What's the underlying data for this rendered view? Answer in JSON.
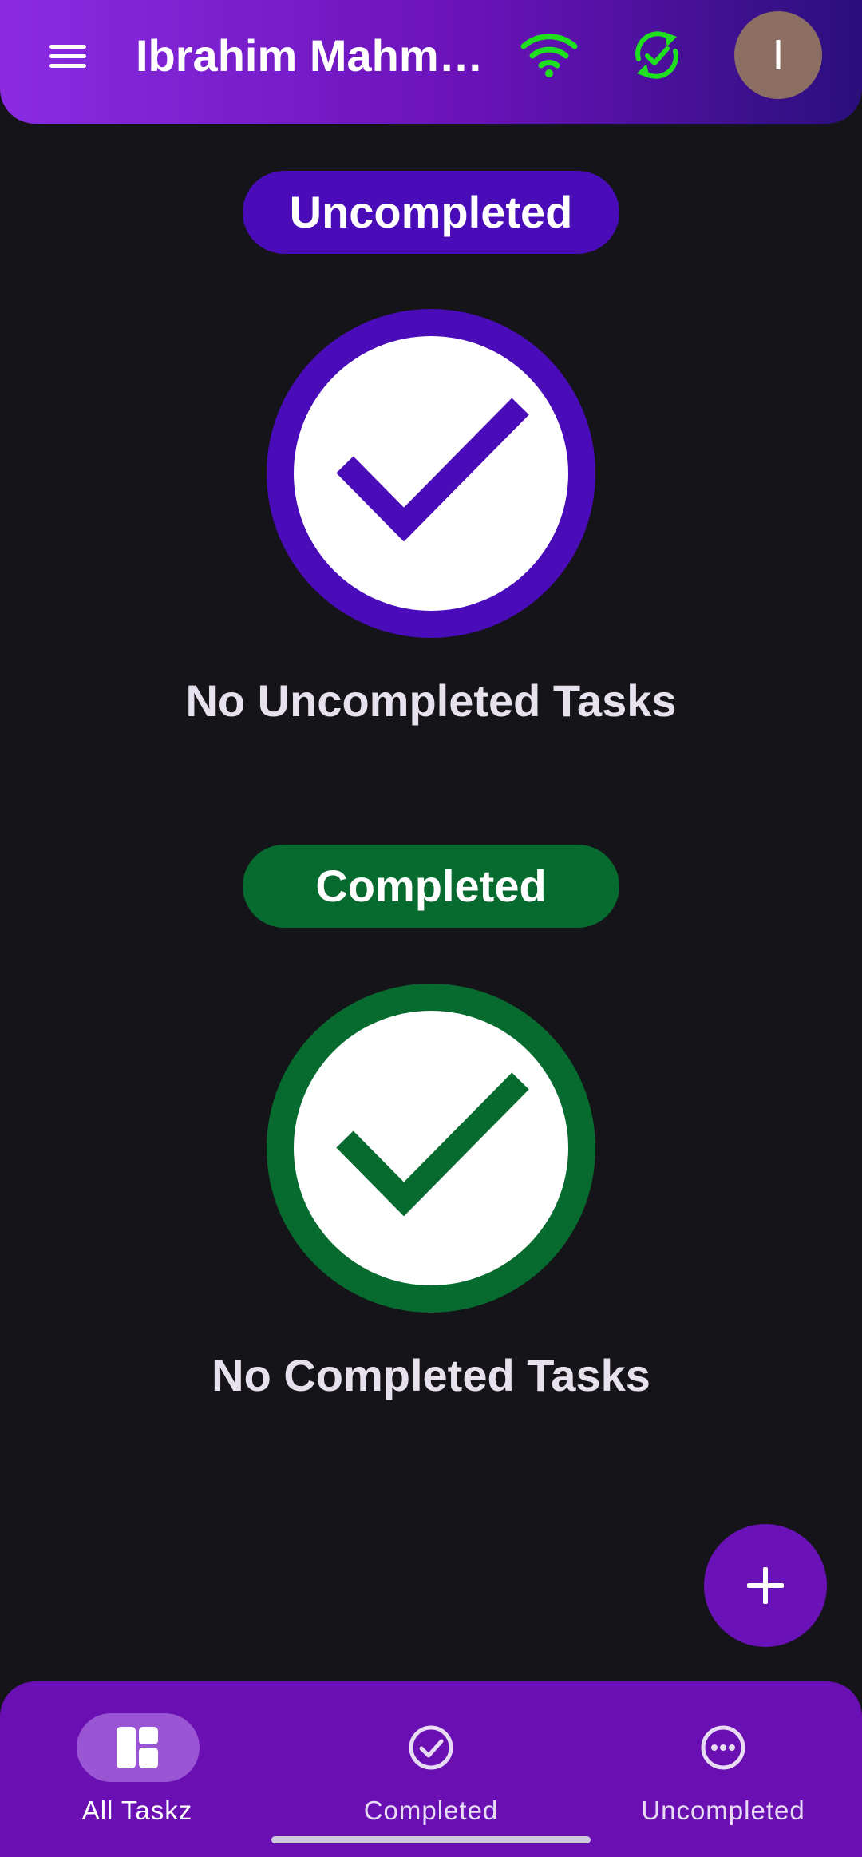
{
  "app_bar": {
    "title": "Ibrahim Mahmoud",
    "menu_icon": "menu-icon",
    "wifi_icon": "wifi-icon",
    "sync_icon": "sync-check-icon",
    "avatar_initial": "I",
    "colors": {
      "gradient_start": "#8a2be2",
      "gradient_end": "#2a0f7c",
      "status_green": "#1fe01f",
      "avatar_bg": "#8c6e63"
    }
  },
  "sections": {
    "uncompleted": {
      "pill_label": "Uncompleted",
      "empty_text": "No Uncompleted Tasks",
      "color": "#4a0cb8"
    },
    "completed": {
      "pill_label": "Completed",
      "empty_text": "No Completed Tasks",
      "color": "#076b30"
    }
  },
  "fab": {
    "icon": "plus-icon",
    "color": "#6a12b8"
  },
  "bottom_nav": {
    "items": [
      {
        "label": "All Taskz",
        "icon": "dashboard-icon",
        "selected": true
      },
      {
        "label": "Completed",
        "icon": "check-circle-icon",
        "selected": false
      },
      {
        "label": "Uncompleted",
        "icon": "more-horizontal-circle-icon",
        "selected": false
      }
    ],
    "color": "#6a0fb2"
  }
}
